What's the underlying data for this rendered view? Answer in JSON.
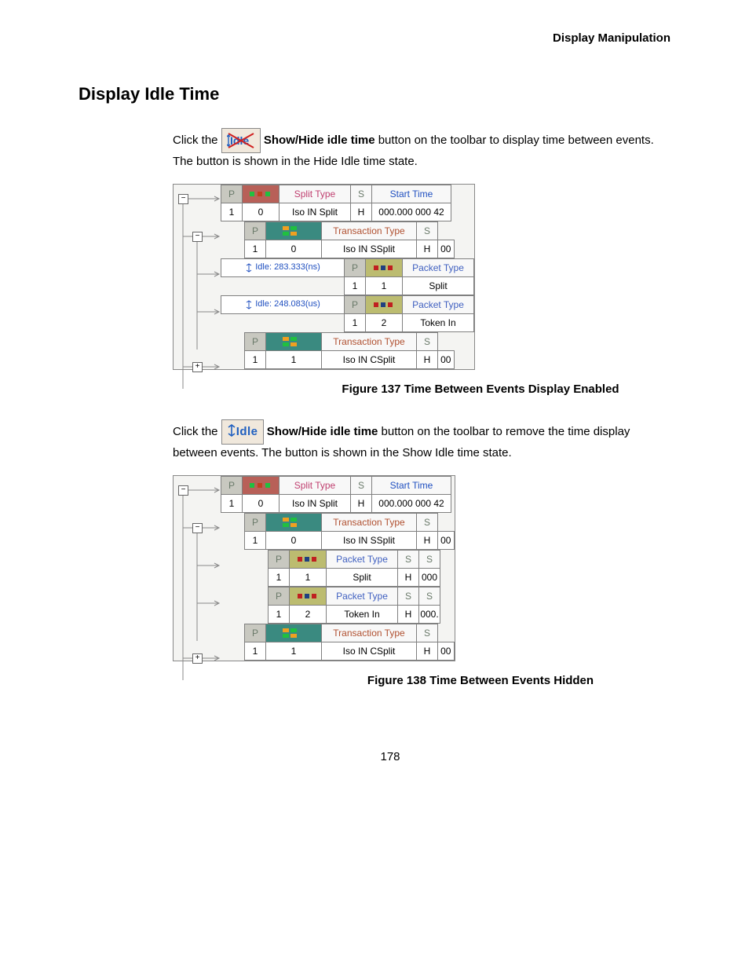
{
  "header": "Display Manipulation",
  "section_title": "Display Idle Time",
  "para1": {
    "pre": "Click the ",
    "bold": "Show/Hide idle time",
    "post": " button on the toolbar to display time between events. The button is shown in the Hide Idle time state."
  },
  "para2": {
    "pre": "Click the ",
    "bold": "Show/Hide idle time",
    "post": " button on the toolbar to remove the time display between events. The button is shown in the Show Idle time state."
  },
  "btn_show_label": "Idle",
  "fig1": "Figure  137  Time Between Events Display Enabled",
  "fig2": "Figure  138  Time Between Events Hidden",
  "page": "178",
  "shot1": {
    "r1": {
      "P": "P",
      "val": "1",
      "zero": "0",
      "split_type": "Split Type",
      "split_val": "Iso IN Split",
      "S": "S",
      "H": "H",
      "start": "Start Time",
      "time": "000.000 000 42"
    },
    "r2": {
      "P": "P",
      "val": "1",
      "zero": "0",
      "trans": "Transaction Type",
      "trans_val": "Iso IN SSplit",
      "S": "S",
      "H": "H",
      "num": "00"
    },
    "idle1": "Idle: 283.333(ns)",
    "r3": {
      "P": "P",
      "val": "1",
      "one": "1",
      "pkt": "Packet Type",
      "pkt_val": "Split"
    },
    "idle2": "Idle: 248.083(us)",
    "r4": {
      "P": "P",
      "val": "1",
      "two": "2",
      "pkt": "Packet Type",
      "pkt_val": "Token In"
    },
    "r5": {
      "P": "P",
      "val": "1",
      "one": "1",
      "trans": "Transaction Type",
      "trans_val": "Iso IN CSplit",
      "S": "S",
      "H": "H",
      "num": "00"
    }
  },
  "shot2": {
    "r1": {
      "P": "P",
      "val": "1",
      "zero": "0",
      "split_type": "Split Type",
      "split_val": "Iso IN Split",
      "S": "S",
      "H": "H",
      "start": "Start Time",
      "time": "000.000 000 42"
    },
    "r2": {
      "P": "P",
      "val": "1",
      "zero": "0",
      "trans": "Transaction Type",
      "trans_val": "Iso IN SSplit",
      "S": "S",
      "H": "H",
      "num": "00"
    },
    "r3": {
      "P": "P",
      "val": "1",
      "one": "1",
      "pkt": "Packet Type",
      "pkt_val": "Split",
      "S": "S",
      "H": "H",
      "num": "000"
    },
    "r4": {
      "P": "P",
      "val": "1",
      "two": "2",
      "pkt": "Packet Type",
      "pkt_val": "Token In",
      "S": "S",
      "H": "H",
      "num": "000."
    },
    "r5": {
      "P": "P",
      "val": "1",
      "one": "1",
      "trans": "Transaction Type",
      "trans_val": "Iso IN CSplit",
      "S": "S",
      "H": "H",
      "num": "00"
    }
  }
}
